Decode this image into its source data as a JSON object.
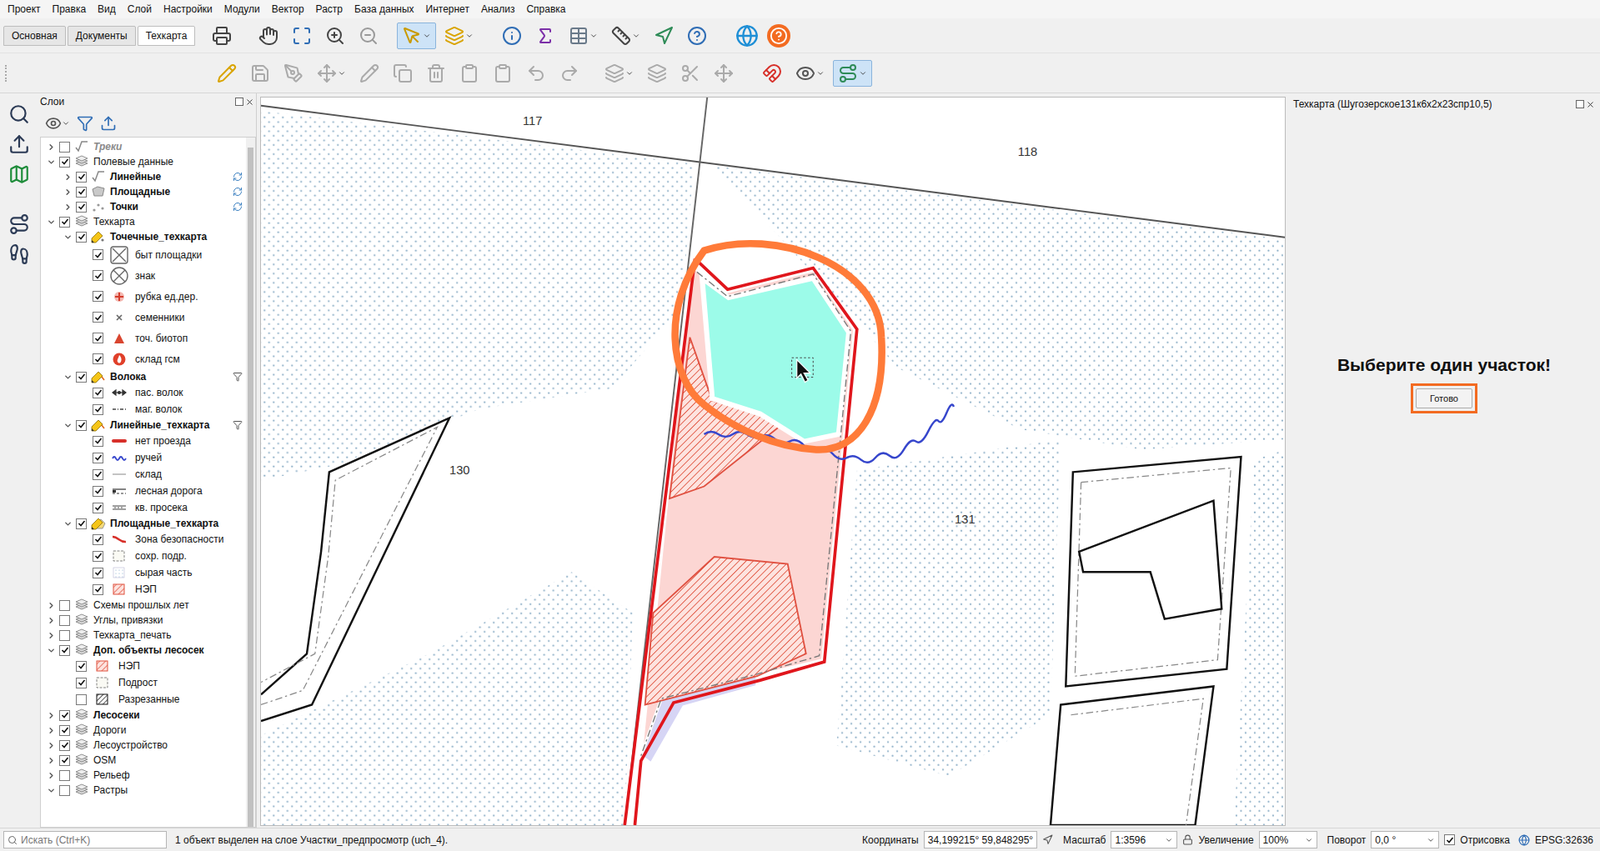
{
  "menu": [
    "Проект",
    "Правка",
    "Вид",
    "Слой",
    "Настройки",
    "Модули",
    "Вектор",
    "Растр",
    "База данных",
    "Интернет",
    "Анализ",
    "Справка"
  ],
  "toolbar_tabs": [
    {
      "label": "Основная",
      "selected": false
    },
    {
      "label": "Документы",
      "selected": false
    },
    {
      "label": "Техкарта",
      "selected": true
    }
  ],
  "layers_panel": {
    "title": "Слои",
    "tree": [
      {
        "label": "Треки",
        "kind": "line",
        "checked": false,
        "bold": true,
        "italic": true,
        "filtered": false,
        "synced": false,
        "expanded": false
      },
      {
        "label": "Полевые данные",
        "kind": "group",
        "checked": true,
        "bold": false,
        "italic": false,
        "filtered": false,
        "synced": false,
        "expanded": true,
        "children": [
          {
            "label": "Линейные",
            "kind": "line",
            "checked": true,
            "bold": true,
            "italic": false,
            "filtered": false,
            "synced": true,
            "expanded": false
          },
          {
            "label": "Площадные",
            "kind": "polygon",
            "checked": true,
            "bold": true,
            "italic": false,
            "filtered": false,
            "synced": true,
            "expanded": false
          },
          {
            "label": "Точки",
            "kind": "point",
            "checked": true,
            "bold": true,
            "italic": false,
            "filtered": false,
            "synced": true,
            "expanded": false
          }
        ]
      },
      {
        "label": "Техкарта",
        "kind": "group",
        "checked": true,
        "bold": false,
        "italic": false,
        "filtered": false,
        "synced": false,
        "expanded": true,
        "children": [
          {
            "label": "Точечные_техкарта",
            "kind": "point-edit",
            "checked": true,
            "bold": true,
            "italic": false,
            "filtered": false,
            "synced": false,
            "expanded": true,
            "children": [
              {
                "label": "быт площадки",
                "kind": "camp",
                "checked": true
              },
              {
                "label": "знак",
                "kind": "sign",
                "checked": true
              },
              {
                "label": "рубка ед.дер.",
                "kind": "cut",
                "checked": true
              },
              {
                "label": "семенники",
                "kind": "seed",
                "checked": true
              },
              {
                "label": "точ. биотоп",
                "kind": "biotope",
                "checked": true
              },
              {
                "label": "склад гсм",
                "kind": "fuel",
                "checked": true
              }
            ]
          },
          {
            "label": "Волока",
            "kind": "line-edit",
            "checked": true,
            "bold": true,
            "italic": false,
            "filtered": true,
            "synced": false,
            "expanded": true,
            "children": [
              {
                "label": "пас. волок",
                "kind": "passive",
                "checked": true
              },
              {
                "label": "маг. волок",
                "kind": "magistral",
                "checked": true
              }
            ]
          },
          {
            "label": "Линейные_техкарта",
            "kind": "line-edit",
            "checked": true,
            "bold": true,
            "italic": false,
            "filtered": true,
            "synced": false,
            "expanded": true,
            "children": [
              {
                "label": "нет проезда",
                "kind": "noroad",
                "checked": true
              },
              {
                "label": "ручей",
                "kind": "stream",
                "checked": true
              },
              {
                "label": "склад",
                "kind": "store",
                "checked": true
              },
              {
                "label": "лесная дорога",
                "kind": "forestroad",
                "checked": true
              },
              {
                "label": "кв. просека",
                "kind": "clearing",
                "checked": true
              }
            ]
          },
          {
            "label": "Площадные_техкарта",
            "kind": "polygon-edit",
            "checked": true,
            "bold": true,
            "italic": false,
            "filtered": false,
            "synced": false,
            "expanded": true,
            "children": [
              {
                "label": "Зона безопасности",
                "kind": "safety",
                "checked": true
              },
              {
                "label": "сохр. подр.",
                "kind": "undergrowth",
                "checked": true
              },
              {
                "label": "сырая часть",
                "kind": "wet",
                "checked": true
              },
              {
                "label": "НЭП",
                "kind": "nep",
                "checked": true
              }
            ]
          }
        ]
      },
      {
        "label": "Схемы прошлых лет",
        "kind": "group",
        "checked": false,
        "bold": false,
        "italic": false,
        "filtered": false,
        "synced": false,
        "expanded": false
      },
      {
        "label": "Углы, привязки",
        "kind": "group",
        "checked": false,
        "bold": false,
        "italic": false,
        "filtered": false,
        "synced": false,
        "expanded": false
      },
      {
        "label": "Техкарта_печать",
        "kind": "group",
        "checked": false,
        "bold": false,
        "italic": false,
        "filtered": false,
        "synced": false,
        "expanded": false
      },
      {
        "label": "Доп. объекты лесосек",
        "kind": "group",
        "checked": true,
        "bold": true,
        "italic": false,
        "filtered": false,
        "synced": false,
        "expanded": true,
        "children": [
          {
            "label": "НЭП",
            "kind": "nep",
            "checked": true
          },
          {
            "label": "Подрост",
            "kind": "undergrowth",
            "checked": true
          },
          {
            "label": "Разрезанные",
            "kind": "hatch",
            "checked": false
          }
        ]
      },
      {
        "label": "Лесосеки",
        "kind": "group",
        "checked": true,
        "bold": true,
        "italic": false,
        "filtered": false,
        "synced": false,
        "expanded": false
      },
      {
        "label": "Дороги",
        "kind": "group",
        "checked": true,
        "bold": false,
        "italic": false,
        "filtered": false,
        "synced": false,
        "expanded": false
      },
      {
        "label": "Лесоустройство",
        "kind": "group",
        "checked": true,
        "bold": false,
        "italic": false,
        "filtered": false,
        "synced": false,
        "expanded": false
      },
      {
        "label": "OSM",
        "kind": "group",
        "checked": true,
        "bold": false,
        "italic": false,
        "filtered": false,
        "synced": false,
        "expanded": false
      },
      {
        "label": "Рельеф",
        "kind": "group",
        "checked": false,
        "bold": false,
        "italic": false,
        "filtered": false,
        "synced": false,
        "expanded": false
      },
      {
        "label": "Растры",
        "kind": "group",
        "checked": false,
        "bold": false,
        "italic": false,
        "filtered": false,
        "synced": false,
        "expanded": true,
        "children": []
      }
    ]
  },
  "map": {
    "labels": [
      "117",
      "118",
      "130",
      "131"
    ],
    "parcel_selected": true,
    "parcel_circled": true
  },
  "tool_panel": {
    "title": "Техкарта (Шугозерское131к6х2х23спр10,5)",
    "prompt": "Выберите один участок!",
    "button": "Готово",
    "button_highlighted": true
  },
  "status_bar": {
    "search_placeholder": "Искать (Ctrl+K)",
    "message": "1 объект выделен на слое Участки_предпросмотр (uch_4).",
    "coordinates_label": "Координаты",
    "coordinates": "34,199215° 59,848295°",
    "scale_label": "Масштаб",
    "scale": "1:3596",
    "magnifier_label": "Увеличение",
    "magnifier": "100%",
    "rotation_label": "Поворот",
    "rotation": "0,0 °",
    "render_label": "Отрисовка",
    "render_checked": true,
    "crs": "EPSG:32636"
  }
}
